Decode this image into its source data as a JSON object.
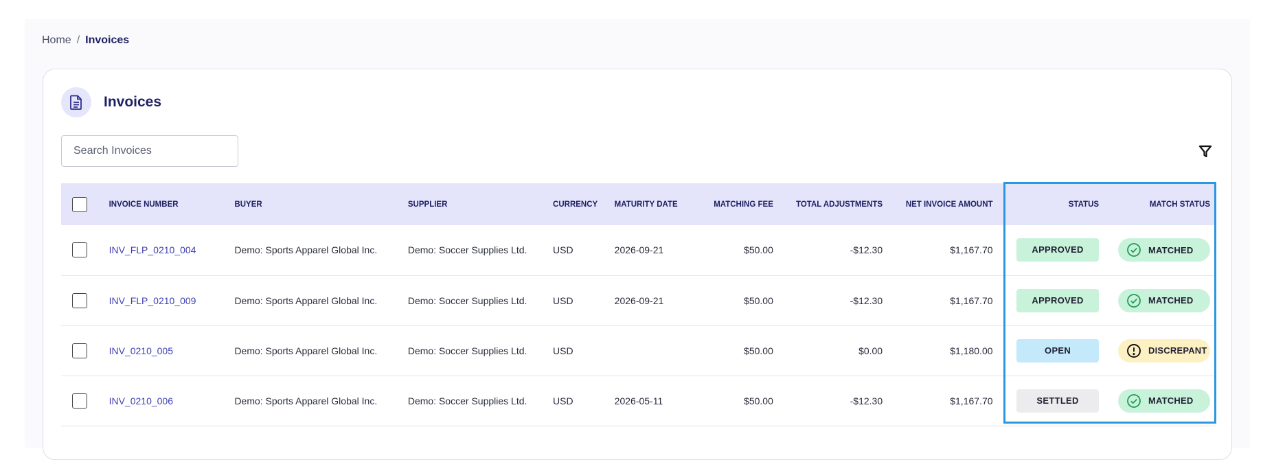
{
  "breadcrumb": {
    "home": "Home",
    "separator": "/",
    "current": "Invoices"
  },
  "card": {
    "title": "Invoices",
    "icon": "document-icon"
  },
  "search": {
    "placeholder": "Search Invoices",
    "value": ""
  },
  "filter": {
    "icon": "filter-icon"
  },
  "table": {
    "columns": {
      "invoice_number": "INVOICE NUMBER",
      "buyer": "BUYER",
      "supplier": "SUPPLIER",
      "currency": "CURRENCY",
      "maturity_date": "MATURITY DATE",
      "matching_fee": "MATCHING FEE",
      "total_adjustments": "TOTAL ADJUSTMENTS",
      "net_invoice_amount": "NET INVOICE AMOUNT",
      "status": "STATUS",
      "match_status": "MATCH STATUS"
    },
    "rows": [
      {
        "invoice_number": "INV_FLP_0210_004",
        "buyer": "Demo: Sports Apparel Global Inc.",
        "supplier": "Demo: Soccer Supplies Ltd.",
        "currency": "USD",
        "maturity_date": "2026-09-21",
        "matching_fee": "$50.00",
        "total_adjustments": "-$12.30",
        "net_invoice_amount": "$1,167.70",
        "status": "APPROVED",
        "match_status": "MATCHED"
      },
      {
        "invoice_number": "INV_FLP_0210_009",
        "buyer": "Demo: Sports Apparel Global Inc.",
        "supplier": "Demo: Soccer Supplies Ltd.",
        "currency": "USD",
        "maturity_date": "2026-09-21",
        "matching_fee": "$50.00",
        "total_adjustments": "-$12.30",
        "net_invoice_amount": "$1,167.70",
        "status": "APPROVED",
        "match_status": "MATCHED"
      },
      {
        "invoice_number": "INV_0210_005",
        "buyer": "Demo: Sports Apparel Global Inc.",
        "supplier": "Demo: Soccer Supplies Ltd.",
        "currency": "USD",
        "maturity_date": "",
        "matching_fee": "$50.00",
        "total_adjustments": "$0.00",
        "net_invoice_amount": "$1,180.00",
        "status": "OPEN",
        "match_status": "DISCREPANT"
      },
      {
        "invoice_number": "INV_0210_006",
        "buyer": "Demo: Sports Apparel Global Inc.",
        "supplier": "Demo: Soccer Supplies Ltd.",
        "currency": "USD",
        "maturity_date": "2026-05-11",
        "matching_fee": "$50.00",
        "total_adjustments": "-$12.30",
        "net_invoice_amount": "$1,167.70",
        "status": "SETTLED",
        "match_status": "MATCHED"
      }
    ]
  },
  "colors": {
    "accent": "#1f2163",
    "link": "#3d3fb5",
    "header_bg": "#e4e4fb",
    "approved": "#c9f2db",
    "open": "#c4e9fb",
    "settled": "#ececee",
    "discrepant": "#fdf1c4",
    "highlight_border": "#2a97e0"
  }
}
